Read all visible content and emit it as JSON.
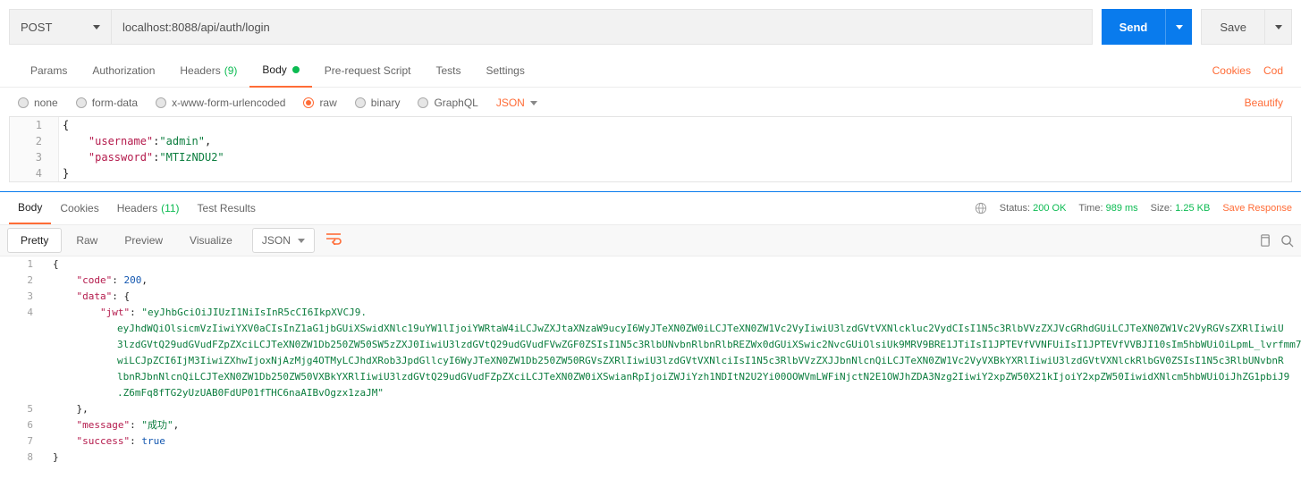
{
  "request": {
    "method": "POST",
    "url": "localhost:8088/api/auth/login",
    "send_label": "Send",
    "save_label": "Save"
  },
  "req_tabs": {
    "params": "Params",
    "authorization": "Authorization",
    "headers": "Headers",
    "headers_count": "(9)",
    "body": "Body",
    "prerequest": "Pre-request Script",
    "tests": "Tests",
    "settings": "Settings",
    "cookies": "Cookies",
    "code": "Cod"
  },
  "body_types": {
    "none": "none",
    "form_data": "form-data",
    "urlencoded": "x-www-form-urlencoded",
    "raw": "raw",
    "binary": "binary",
    "graphql": "GraphQL",
    "content_type": "JSON",
    "beautify": "Beautify"
  },
  "request_body": {
    "username_key": "\"username\"",
    "username_val": "\"admin\"",
    "password_key": "\"password\"",
    "password_val": "\"MTIzNDU2\""
  },
  "resp_tabs": {
    "body": "Body",
    "cookies": "Cookies",
    "headers": "Headers",
    "headers_count": "(11)",
    "test_results": "Test Results"
  },
  "resp_status": {
    "status_label": "Status:",
    "status_value": "200 OK",
    "time_label": "Time:",
    "time_value": "989 ms",
    "size_label": "Size:",
    "size_value": "1.25 KB",
    "save_response": "Save Response"
  },
  "resp_toolbar": {
    "pretty": "Pretty",
    "raw": "Raw",
    "preview": "Preview",
    "visualize": "Visualize",
    "format": "JSON"
  },
  "response_body": {
    "code_key": "\"code\"",
    "code_val": "200",
    "data_key": "\"data\"",
    "jwt_key": "\"jwt\"",
    "jwt_val_start": "\"eyJhbGciOiJIUzI1NiIsInR5cCI6IkpXVCJ9.",
    "jwt_line2": "eyJhdWQiOlsicmVzIiwiYXV0aCIsInZ1aG1jbGUiXSwidXNlc19uYW1lIjoiYWRtaW4iLCJwZXJtaXNzaW9ucyI6WyJTeXN0ZW0iLCJTeXN0ZW1Vc2VyIiwiU3lzdGVtVXNlckluc2VydCIsI1N5c3RlbVVzZXJVcGRhdGUiLCJTeXN0ZW1Vc2VyRGVsZXRlIiwiU",
    "jwt_line3": "3lzdGVtQ29udGVudFZpZXciLCJTeXN0ZW1Db250ZW50SW5zZXJ0IiwiU3lzdGVtQ29udGVudFVwZGF0ZSIsI1N5c3RlbUNvbnRlbnRlbREZWx0dGUiXSwic2NvcGUiOlsiUk9MRV9BRE1JTiIsI1JPTEVfVVNFUiIsI1JPTEVfVVBJI10sIm5hbWUiOiLpmL_lvrfmm7",
    "jwt_line4": "wiLCJpZCI6IjM3IiwiZXhwIjoxNjAzMjg4OTMyLCJhdXRob3JpdGllcyI6WyJTeXN0ZW1Db250ZW50RGVsZXRlIiwiU3lzdGVtVXNlciIsI1N5c3RlbVVzZXJJbnNlcnQiLCJTeXN0ZW1Vc2VyVXBkYXRlIiwiU3lzdGVtVXNlckRlbGV0ZSIsI1N5c3RlbUNvbnR",
    "jwt_line5": "lbnRJbnNlcnQiLCJTeXN0ZW1Db250ZW50VXBkYXRlIiwiU3lzdGVtQ29udGVudFZpZXciLCJTeXN0ZW0iXSwianRpIjoiZWJiYzh1NDItN2U2Yi00OOWVmLWFiNjctN2E1OWJhZDA3Nzg2IiwiY2xpZW50X21kIjoiY2xpZW50IiwidXNlcm5hbWUiOiJhZG1pbiJ9",
    "jwt_line6": ".Z6mFq8fTG2yUzUAB0FdUP01fTHC6naAIBvOgzx1zaJM\"",
    "message_key": "\"message\"",
    "message_val": "\"成功\"",
    "success_key": "\"success\"",
    "success_val": "true"
  }
}
